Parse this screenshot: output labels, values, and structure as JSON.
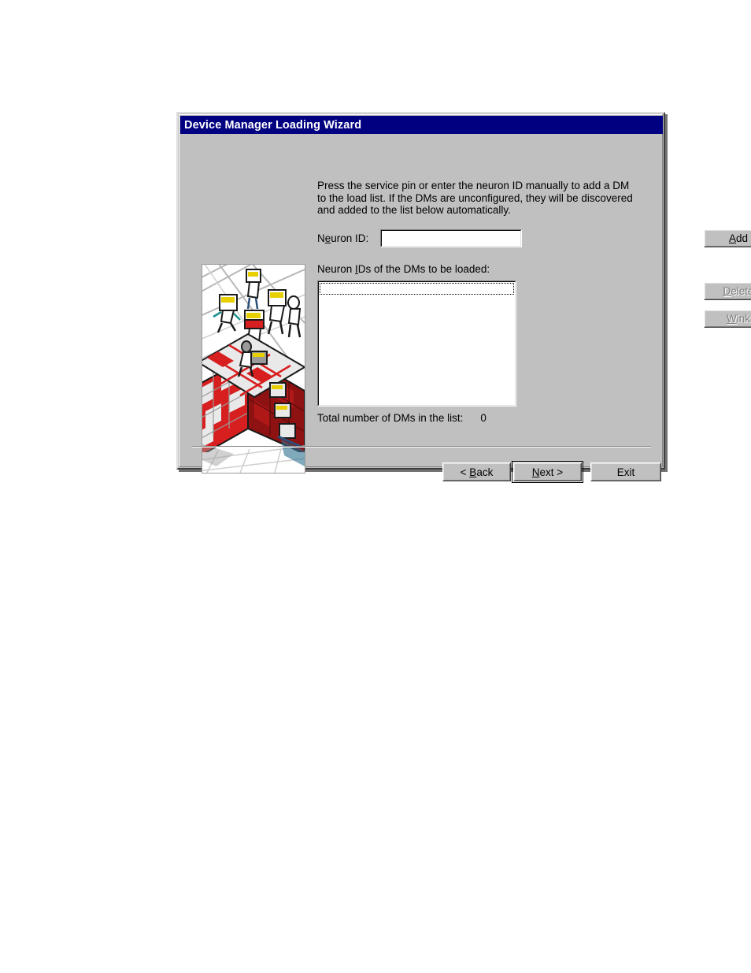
{
  "window": {
    "title": "Device Manager Loading Wizard"
  },
  "artwork": {
    "name": "wizard-illustration",
    "description": "Isometric illustration of figures assembling a red and white cube structure"
  },
  "main": {
    "instruction": "Press the service pin or enter the neuron ID manually to add a DM to the load list. If the DMs are unconfigured, they will be discovered and added to the list below automatically.",
    "neuron_id": {
      "label_prefix": "N",
      "label_accel": "e",
      "label_suffix": "uron ID:",
      "value": "",
      "placeholder": ""
    },
    "add_button": {
      "accel": "A",
      "rest": "dd"
    },
    "list_label": {
      "prefix": "Neuron ",
      "accel": "I",
      "suffix": "Ds of the DMs to be loaded:"
    },
    "list_items": [],
    "delete_button": {
      "accel": "D",
      "rest": "elete",
      "enabled": false
    },
    "wink_button": {
      "accel": "W",
      "rest": "ink",
      "enabled": false
    },
    "total_label": "Total number of DMs in the list:",
    "total_count": "0"
  },
  "footer": {
    "back_button": {
      "prefix": "< ",
      "accel": "B",
      "rest": "ack"
    },
    "next_button": {
      "accel": "N",
      "rest": "ext >"
    },
    "exit_button": {
      "label": "Exit"
    }
  },
  "colors": {
    "title_bar": "#000080",
    "title_text": "#ffffff",
    "dialog_face": "#c0c0c0",
    "field_background": "#ffffff",
    "disabled_text": "#808080",
    "page_background": "#ffffff"
  }
}
